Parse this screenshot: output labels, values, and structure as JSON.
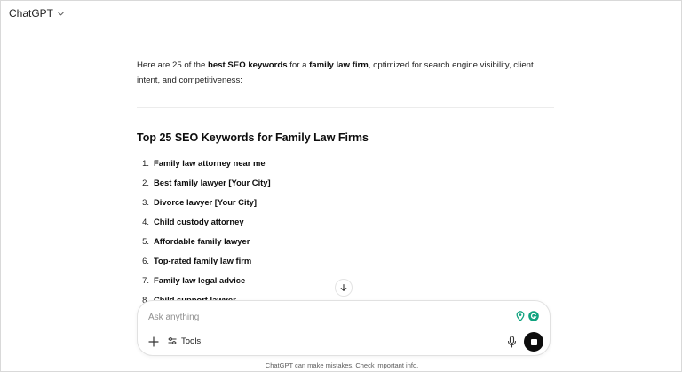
{
  "header": {
    "model_name": "ChatGPT"
  },
  "message": {
    "intro": {
      "parts": [
        {
          "text": "Here are 25 of the ",
          "bold": false
        },
        {
          "text": "best SEO keywords",
          "bold": true
        },
        {
          "text": " for a ",
          "bold": false
        },
        {
          "text": "family law firm",
          "bold": true
        },
        {
          "text": ", optimized for search engine visibility, client intent, and competitiveness:",
          "bold": false
        }
      ]
    },
    "heading": "Top 25 SEO Keywords for Family Law Firms",
    "keywords": [
      {
        "num": "1.",
        "text": "Family law attorney near me"
      },
      {
        "num": "2.",
        "text": "Best family lawyer [Your City]"
      },
      {
        "num": "3.",
        "text": "Divorce lawyer [Your City]"
      },
      {
        "num": "4.",
        "text": "Child custody attorney"
      },
      {
        "num": "5.",
        "text": "Affordable family lawyer"
      },
      {
        "num": "6.",
        "text": "Top-rated family law firm"
      },
      {
        "num": "7.",
        "text": "Family law legal advice"
      },
      {
        "num": "8.",
        "text": "Child support lawyer"
      }
    ]
  },
  "composer": {
    "placeholder": "Ask anything",
    "tools_label": "Tools"
  },
  "footer": {
    "disclaimer": "ChatGPT can make mistakes. Check important info."
  },
  "colors": {
    "extension_green": "#10a37f",
    "stop_button": "#0d0d0d"
  },
  "icons": [
    "chevron-down-icon",
    "arrow-down-icon",
    "plus-icon",
    "tools-icon",
    "microphone-icon",
    "stop-icon",
    "location-pin-icon",
    "grammarly-icon"
  ]
}
